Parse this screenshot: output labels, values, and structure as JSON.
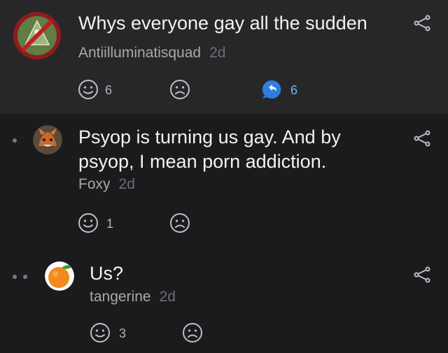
{
  "post": {
    "title": "Whys everyone gay all the sudden",
    "author": "Antiilluminatisquad",
    "age": "2d",
    "like_count": "6",
    "reply_count": "6"
  },
  "replies": [
    {
      "text_line1": "Psyop is turning us gay. And by",
      "text_line2": "psyop, I mean porn addiction.",
      "author": "Foxy",
      "age": "2d",
      "like_count": "1"
    },
    {
      "text_line1": "Us?",
      "author": "tangerine",
      "age": "2d",
      "like_count": "3"
    }
  ],
  "colors": {
    "background": "#1b1b1e",
    "post_background": "#27272a",
    "accent_blue": "#2f7de1"
  },
  "icons": [
    "share-icon",
    "smiley-icon",
    "frown-icon",
    "reply-bubble-icon",
    "thread-dot"
  ]
}
